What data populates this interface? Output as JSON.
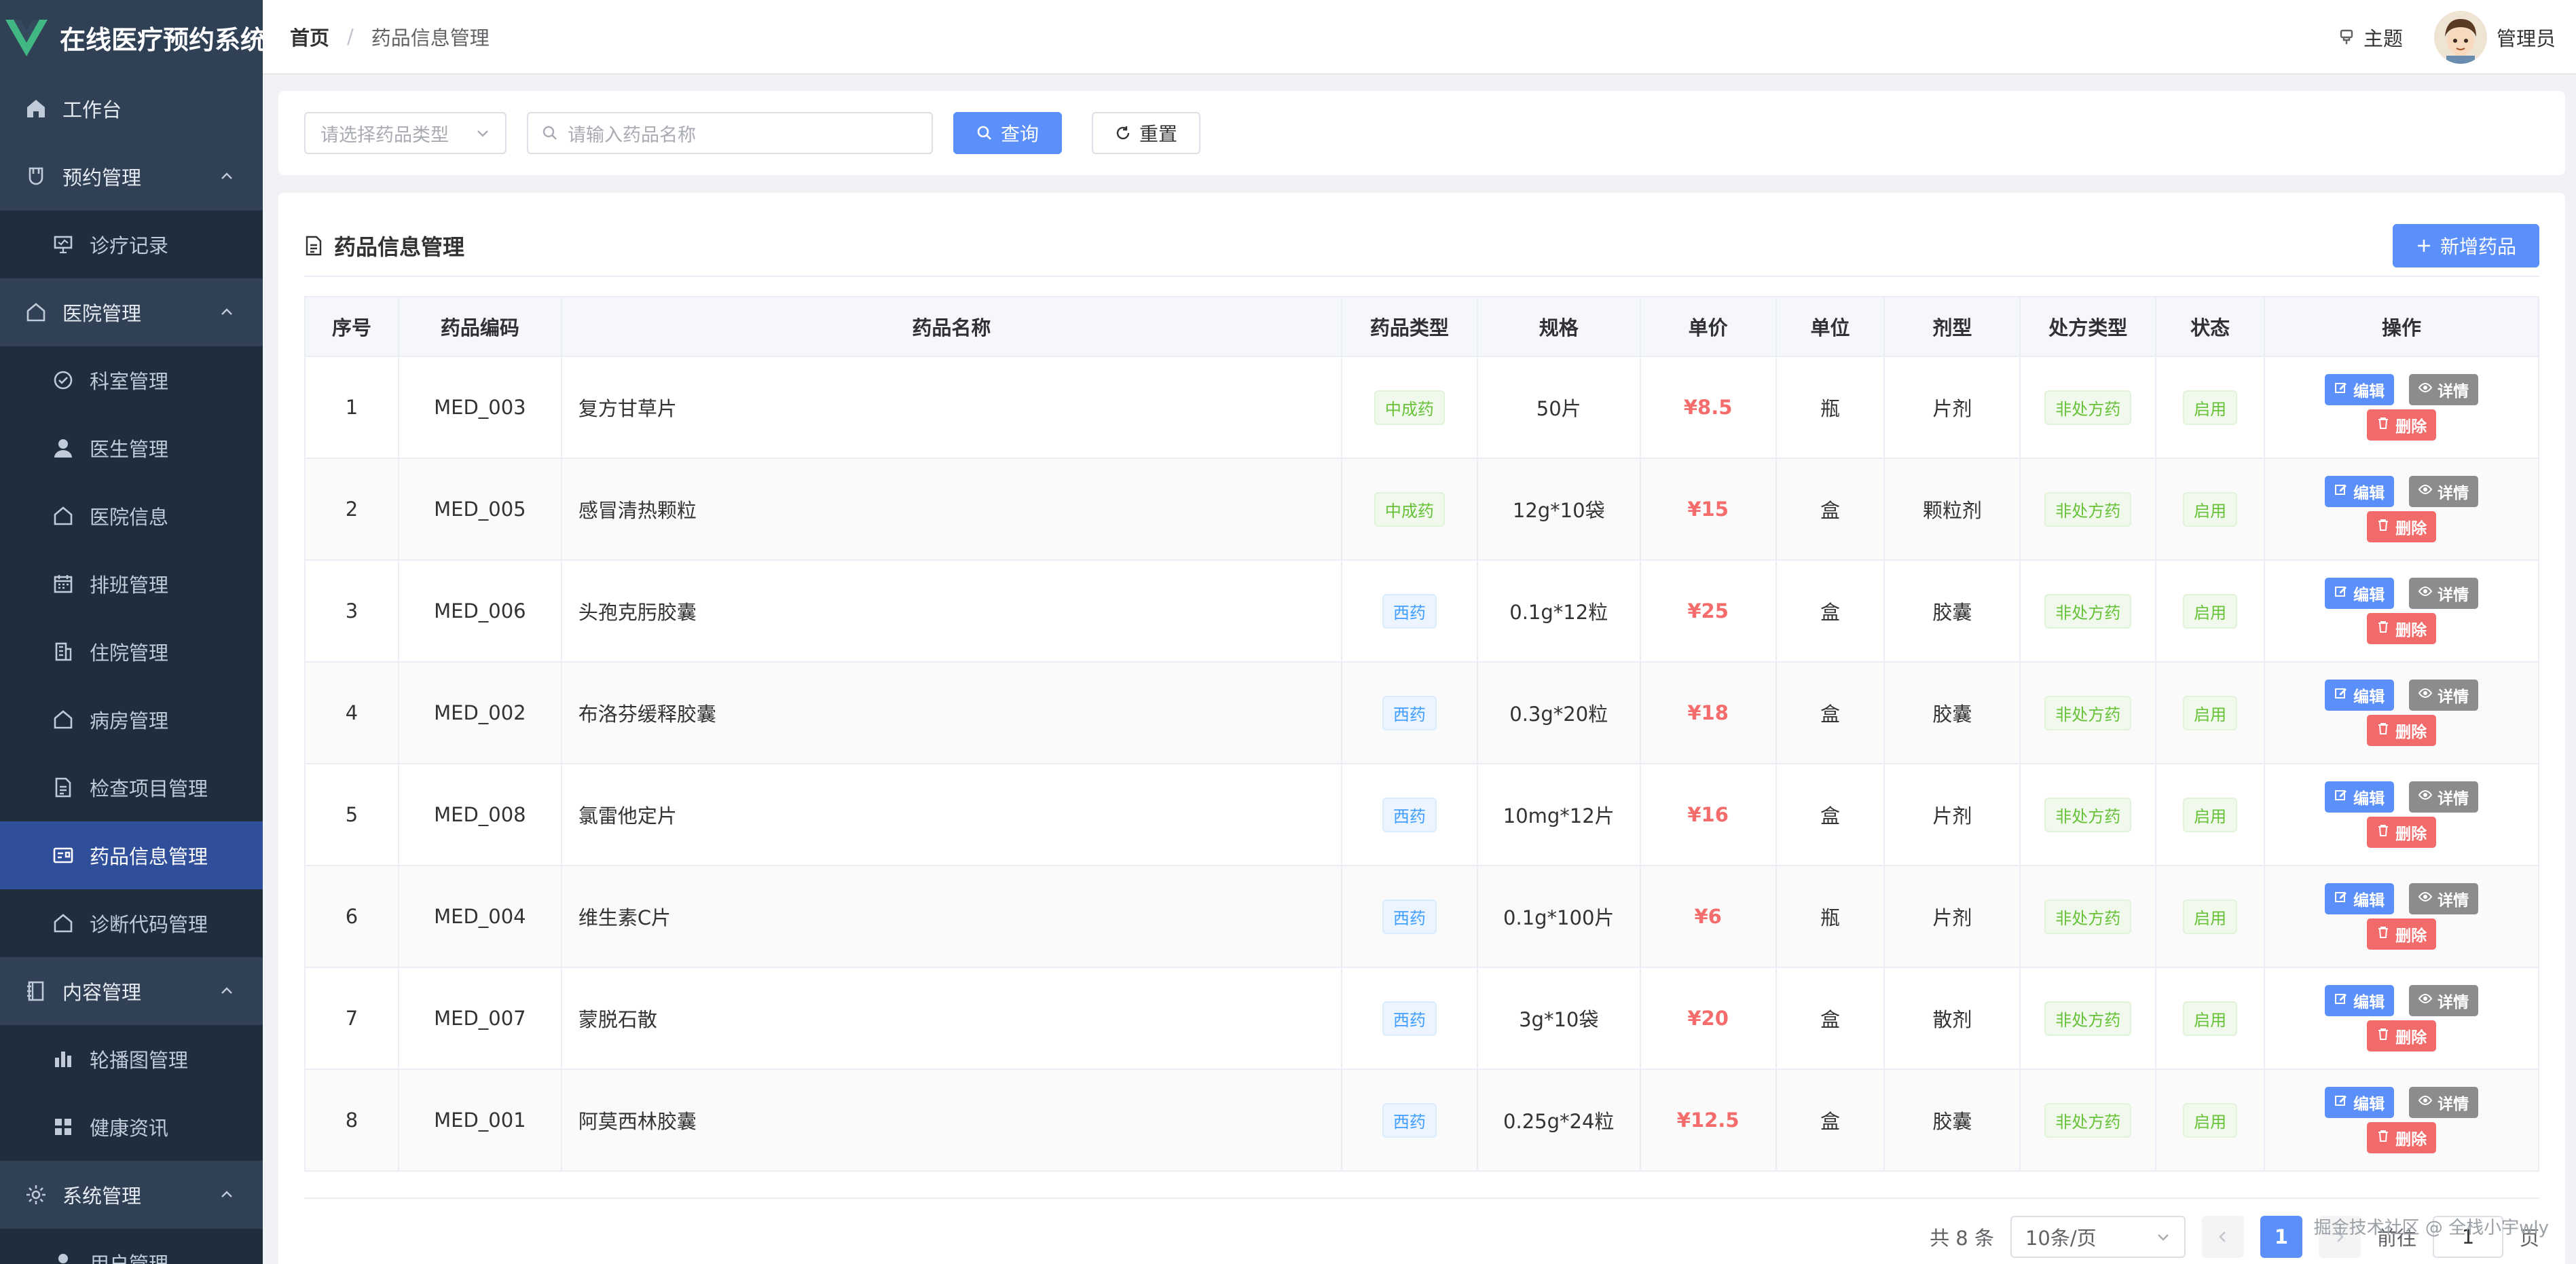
{
  "app": {
    "title": "在线医疗预约系统"
  },
  "sidebar": {
    "items": [
      {
        "label": "工作台",
        "icon": "home-icon",
        "level": 1,
        "chev": false
      },
      {
        "label": "预约管理",
        "icon": "cup-icon",
        "level": 1,
        "chev": true
      },
      {
        "label": "诊疗记录",
        "icon": "monitor-icon",
        "level": 2,
        "chev": false
      },
      {
        "label": "医院管理",
        "icon": "house-icon",
        "level": 1,
        "chev": true
      },
      {
        "label": "科室管理",
        "icon": "check-circle-icon",
        "level": 2,
        "chev": false
      },
      {
        "label": "医生管理",
        "icon": "user-icon",
        "level": 2,
        "chev": false
      },
      {
        "label": "医院信息",
        "icon": "house-icon",
        "level": 2,
        "chev": false
      },
      {
        "label": "排班管理",
        "icon": "calendar-icon",
        "level": 2,
        "chev": false
      },
      {
        "label": "住院管理",
        "icon": "building-icon",
        "level": 2,
        "chev": false
      },
      {
        "label": "病房管理",
        "icon": "house-icon",
        "level": 2,
        "chev": false
      },
      {
        "label": "检查项目管理",
        "icon": "document-icon",
        "level": 2,
        "chev": false
      },
      {
        "label": "药品信息管理",
        "icon": "postcard-icon",
        "level": 2,
        "chev": false,
        "active": true
      },
      {
        "label": "诊断代码管理",
        "icon": "house-icon",
        "level": 2,
        "chev": false
      },
      {
        "label": "内容管理",
        "icon": "notebook-icon",
        "level": 1,
        "chev": true
      },
      {
        "label": "轮播图管理",
        "icon": "bar-chart-icon",
        "level": 2,
        "chev": false
      },
      {
        "label": "健康资讯",
        "icon": "grid-icon",
        "level": 2,
        "chev": false
      },
      {
        "label": "系统管理",
        "icon": "gear-icon",
        "level": 1,
        "chev": true
      },
      {
        "label": "用户管理",
        "icon": "user-icon",
        "level": 2,
        "chev": false
      }
    ]
  },
  "header": {
    "breadcrumb_home": "首页",
    "breadcrumb_sep": "/",
    "breadcrumb_current": "药品信息管理",
    "theme_label": "主题",
    "user_name": "管理员"
  },
  "search": {
    "type_placeholder": "请选择药品类型",
    "name_placeholder": "请输入药品名称",
    "query_label": "查询",
    "reset_label": "重置"
  },
  "panel": {
    "title": "药品信息管理",
    "add_label": "新增药品"
  },
  "table": {
    "columns": [
      "序号",
      "药品编码",
      "药品名称",
      "药品类型",
      "规格",
      "单价",
      "单位",
      "剂型",
      "处方类型",
      "状态",
      "操作"
    ],
    "actions": {
      "edit": "编辑",
      "detail": "详情",
      "delete": "删除"
    },
    "rows": [
      {
        "no": "1",
        "code": "MED_003",
        "name": "复方甘草片",
        "type": "中成药",
        "spec": "50片",
        "price": "¥8.5",
        "unit": "瓶",
        "form": "片剂",
        "rx": "非处方药",
        "status": "启用"
      },
      {
        "no": "2",
        "code": "MED_005",
        "name": "感冒清热颗粒",
        "type": "中成药",
        "spec": "12g*10袋",
        "price": "¥15",
        "unit": "盒",
        "form": "颗粒剂",
        "rx": "非处方药",
        "status": "启用"
      },
      {
        "no": "3",
        "code": "MED_006",
        "name": "头孢克肟胶囊",
        "type": "西药",
        "spec": "0.1g*12粒",
        "price": "¥25",
        "unit": "盒",
        "form": "胶囊",
        "rx": "非处方药",
        "status": "启用"
      },
      {
        "no": "4",
        "code": "MED_002",
        "name": "布洛芬缓释胶囊",
        "type": "西药",
        "spec": "0.3g*20粒",
        "price": "¥18",
        "unit": "盒",
        "form": "胶囊",
        "rx": "非处方药",
        "status": "启用"
      },
      {
        "no": "5",
        "code": "MED_008",
        "name": "氯雷他定片",
        "type": "西药",
        "spec": "10mg*12片",
        "price": "¥16",
        "unit": "盒",
        "form": "片剂",
        "rx": "非处方药",
        "status": "启用"
      },
      {
        "no": "6",
        "code": "MED_004",
        "name": "维生素C片",
        "type": "西药",
        "spec": "0.1g*100片",
        "price": "¥6",
        "unit": "瓶",
        "form": "片剂",
        "rx": "非处方药",
        "status": "启用"
      },
      {
        "no": "7",
        "code": "MED_007",
        "name": "蒙脱石散",
        "type": "西药",
        "spec": "3g*10袋",
        "price": "¥20",
        "unit": "盒",
        "form": "散剂",
        "rx": "非处方药",
        "status": "启用"
      },
      {
        "no": "8",
        "code": "MED_001",
        "name": "阿莫西林胶囊",
        "type": "西药",
        "spec": "0.25g*24粒",
        "price": "¥12.5",
        "unit": "盒",
        "form": "胶囊",
        "rx": "非处方药",
        "status": "启用"
      }
    ]
  },
  "pagination": {
    "total_text": "共 8 条",
    "page_size": "10条/页",
    "current_page": "1",
    "goto_label": "前往",
    "goto_value": "1",
    "page_suffix": "页"
  },
  "watermark": "掘金技术社区 @ 全栈小宇wly",
  "colors": {
    "sidebar_bg": "#304156",
    "active_bg": "#304f9a",
    "primary": "#5b8ff9",
    "price": "#f56c6c"
  }
}
